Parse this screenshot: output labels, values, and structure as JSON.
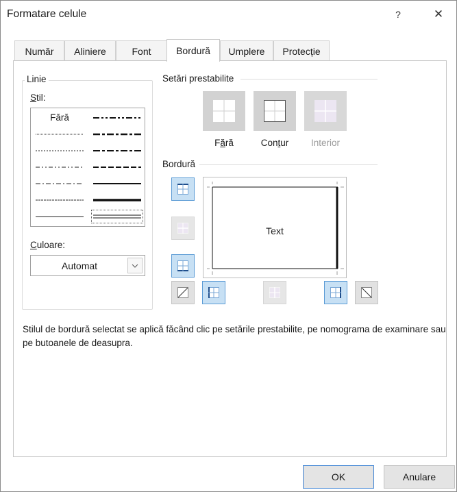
{
  "window": {
    "title": "Formatare celule",
    "help_label": "?",
    "close_label": "✕"
  },
  "tabs": [
    {
      "label": "Număr"
    },
    {
      "label": "Aliniere"
    },
    {
      "label": "Font"
    },
    {
      "label": "Bordură",
      "active": true
    },
    {
      "label": "Umplere"
    },
    {
      "label": "Protecție"
    }
  ],
  "line_group": {
    "title": "Linie",
    "style_label_u": "S",
    "style_label_rest": "til:",
    "none_style_label": "Fără",
    "color_label_u": "C",
    "color_label_rest": "uloare:",
    "color_value": "Automat"
  },
  "presets": {
    "title": "Setări prestabilite",
    "none": {
      "pre": "F",
      "u": "ă",
      "post": "ră"
    },
    "outline": {
      "pre": "Con",
      "u": "t",
      "post": "ur"
    },
    "inside": {
      "label": "Interior"
    }
  },
  "border_group": {
    "title": "Bordură",
    "preview_text": "Text"
  },
  "description": "Stilul de bordură selectat se aplică făcând clic pe setările prestabilite, pe nomograma de examinare sau pe butoanele de deasupra.",
  "footer": {
    "ok_label": "OK",
    "cancel_label": "Anulare"
  },
  "colors": {
    "selected_button_bg": "#c7e0f4",
    "selected_button_border": "#5b9bd5",
    "ok_border": "#3c82d4"
  }
}
